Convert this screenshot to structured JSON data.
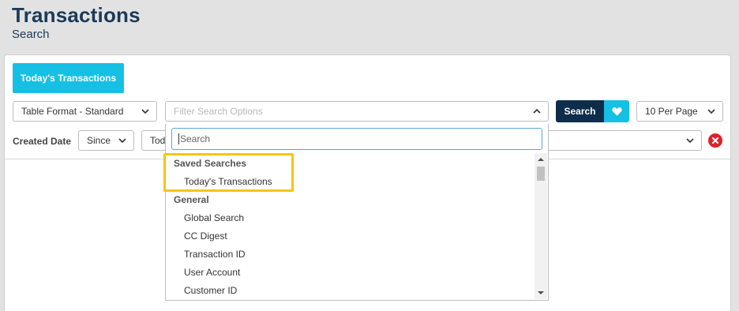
{
  "header": {
    "title": "Transactions",
    "subtitle": "Search"
  },
  "toolbar": {
    "today_button": "Today's Transactions",
    "table_format": "Table Format - Standard",
    "filter_placeholder": "Filter Search Options",
    "search_button": "Search",
    "per_page": "10 Per Page"
  },
  "filters": {
    "created_date_label": "Created Date",
    "since_value": "Since",
    "partial_value": "Tod"
  },
  "dropdown": {
    "search_placeholder": "Search",
    "groups": [
      {
        "label": "Saved Searches",
        "items": [
          "Today's Transactions"
        ]
      },
      {
        "label": "General",
        "items": [
          "Global Search",
          "CC Digest",
          "Transaction ID",
          "User Account",
          "Customer ID"
        ]
      }
    ]
  },
  "colors": {
    "accent": "#16c0e4",
    "navy": "#0e2d4b",
    "title": "#1c3a57",
    "highlight": "#f5c518",
    "danger": "#e2202a"
  },
  "icons": {
    "heart": "heart-icon",
    "clear": "clear-icon",
    "chevron": "chevron-down-icon"
  }
}
